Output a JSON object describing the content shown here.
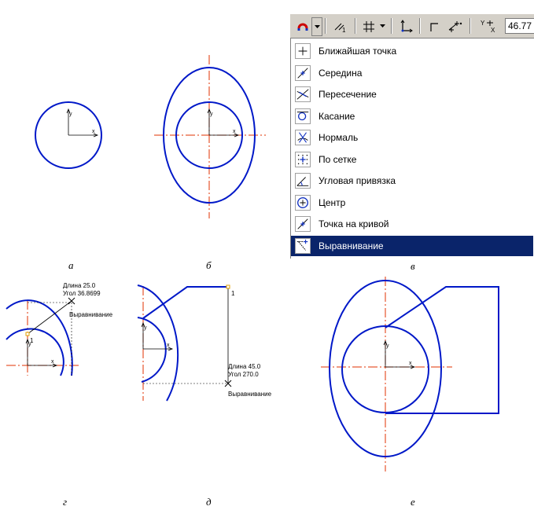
{
  "toolbar": {
    "coord_value": "46.77",
    "coord_icon_label": "Y X"
  },
  "menu": {
    "items": [
      {
        "label": "Ближайшая точка",
        "icon": "nearest-point-icon",
        "selected": false
      },
      {
        "label": "Середина",
        "icon": "midpoint-icon",
        "selected": false
      },
      {
        "label": "Пересечение",
        "icon": "intersection-icon",
        "selected": false
      },
      {
        "label": "Касание",
        "icon": "tangent-icon",
        "selected": false
      },
      {
        "label": "Нормаль",
        "icon": "normal-icon",
        "selected": false
      },
      {
        "label": "По сетке",
        "icon": "grid-snap-icon",
        "selected": false
      },
      {
        "label": "Угловая привязка",
        "icon": "angle-snap-icon",
        "selected": false
      },
      {
        "label": "Центр",
        "icon": "center-icon",
        "selected": false
      },
      {
        "label": "Точка на кривой",
        "icon": "point-on-curve-icon",
        "selected": false
      },
      {
        "label": "Выравнивание",
        "icon": "alignment-icon",
        "selected": true
      }
    ]
  },
  "captions": {
    "a": "а",
    "b": "б",
    "v": "в",
    "g": "г",
    "d": "д",
    "e": "е"
  },
  "annotations": {
    "g_length": "Длина 25.0",
    "g_angle": "Угол 36.8699",
    "g_mode": "Выравнивание",
    "g_point": "1",
    "d_length": "Длина 45.0",
    "d_angle": "Угол 270.0",
    "d_mode": "Выравнивание",
    "d_point": "1"
  },
  "colors": {
    "curve": "#0018c8",
    "axis": "#e03000",
    "menu_selected": "#0a246a",
    "toolbar_bg": "#d4d0c8"
  }
}
